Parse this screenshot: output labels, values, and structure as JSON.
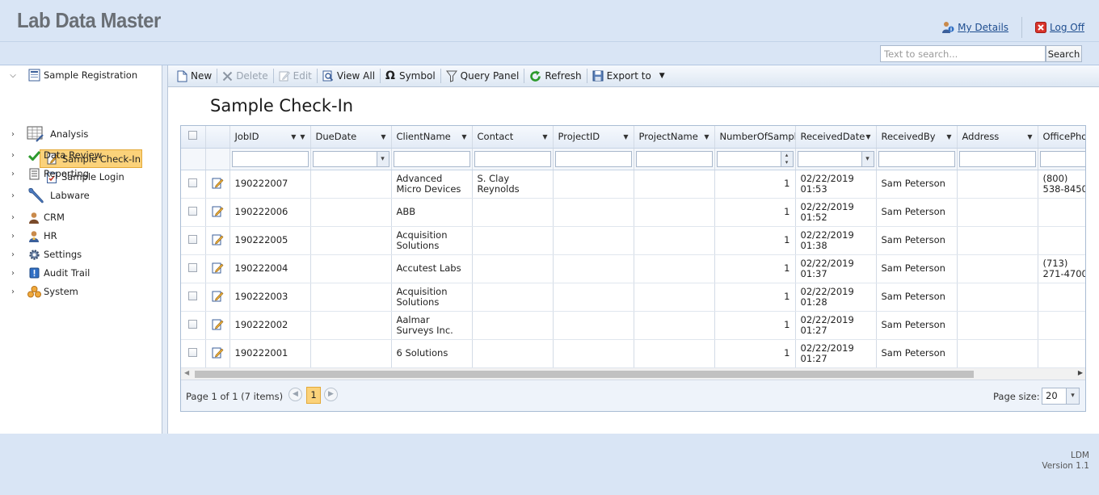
{
  "app": {
    "title": "Lab Data Master",
    "my_details": "My Details",
    "log_off": "Log Off",
    "search_placeholder": "Text to search...",
    "search_button": "Search"
  },
  "sidebar": {
    "items": [
      {
        "label": "Sample Registration",
        "icon": "form-icon",
        "expanded": true
      },
      {
        "label": "Analysis",
        "icon": "table-chart-icon"
      },
      {
        "label": "Data Review",
        "icon": "checkmark-icon"
      },
      {
        "label": "Reporting",
        "icon": "report-icon"
      },
      {
        "label": "Labware",
        "icon": "wrench-icon"
      },
      {
        "label": "CRM",
        "icon": "person-icon"
      },
      {
        "label": "HR",
        "icon": "person-badge-icon"
      },
      {
        "label": "Settings",
        "icon": "gear-icon"
      },
      {
        "label": "Audit Trail",
        "icon": "audit-icon"
      },
      {
        "label": "System",
        "icon": "cubes-icon"
      }
    ],
    "sub_items": [
      {
        "label": "Sample Check-In",
        "selected": true
      },
      {
        "label": "Sample Login"
      }
    ]
  },
  "toolbar": {
    "new": "New",
    "delete": "Delete",
    "edit": "Edit",
    "view_all": "View All",
    "symbol": "Symbol",
    "query_panel": "Query Panel",
    "refresh": "Refresh",
    "export_to": "Export to"
  },
  "page": {
    "title": "Sample Check-In"
  },
  "grid": {
    "columns": [
      "JobID",
      "DueDate",
      "ClientName",
      "Contact",
      "ProjectID",
      "ProjectName",
      "NumberOfSamples",
      "ReceivedDate",
      "ReceivedBy",
      "Address",
      "OfficePhone"
    ],
    "rows": [
      {
        "job_id": "190222007",
        "due_date": "",
        "client": "Advanced Micro Devices",
        "contact": "S. Clay Reynolds",
        "project_id": "",
        "project_name": "",
        "samples": "1",
        "received": "02/22/2019 01:53",
        "received_by": "Sam Peterson",
        "address": "",
        "phone": "(800) 538-8450"
      },
      {
        "job_id": "190222006",
        "due_date": "",
        "client": "ABB",
        "contact": "",
        "project_id": "",
        "project_name": "",
        "samples": "1",
        "received": "02/22/2019 01:52",
        "received_by": "Sam Peterson",
        "address": "",
        "phone": ""
      },
      {
        "job_id": "190222005",
        "due_date": "",
        "client": "Acquisition Solutions",
        "contact": "",
        "project_id": "",
        "project_name": "",
        "samples": "1",
        "received": "02/22/2019 01:38",
        "received_by": "Sam Peterson",
        "address": "",
        "phone": ""
      },
      {
        "job_id": "190222004",
        "due_date": "",
        "client": "Accutest Labs",
        "contact": "",
        "project_id": "",
        "project_name": "",
        "samples": "1",
        "received": "02/22/2019 01:37",
        "received_by": "Sam Peterson",
        "address": "",
        "phone": "(713) 271-4700"
      },
      {
        "job_id": "190222003",
        "due_date": "",
        "client": "Acquisition Solutions",
        "contact": "",
        "project_id": "",
        "project_name": "",
        "samples": "1",
        "received": "02/22/2019 01:28",
        "received_by": "Sam Peterson",
        "address": "",
        "phone": ""
      },
      {
        "job_id": "190222002",
        "due_date": "",
        "client": "Aalmar Surveys Inc.",
        "contact": "",
        "project_id": "",
        "project_name": "",
        "samples": "1",
        "received": "02/22/2019 01:27",
        "received_by": "Sam Peterson",
        "address": "",
        "phone": ""
      },
      {
        "job_id": "190222001",
        "due_date": "",
        "client": "6 Solutions",
        "contact": "",
        "project_id": "",
        "project_name": "",
        "samples": "1",
        "received": "02/22/2019 01:27",
        "received_by": "Sam Peterson",
        "address": "",
        "phone": ""
      }
    ]
  },
  "pager": {
    "summary": "Page 1 of 1 (7 items)",
    "current_page": "1",
    "page_size_label": "Page size:",
    "page_size": "20"
  },
  "footer": {
    "line1": "LDM",
    "line2": "Version 1.1"
  },
  "colors": {
    "header_bg": "#d9e5f5",
    "selected_bg": "#fbd27a",
    "link": "#1e4d8f"
  }
}
